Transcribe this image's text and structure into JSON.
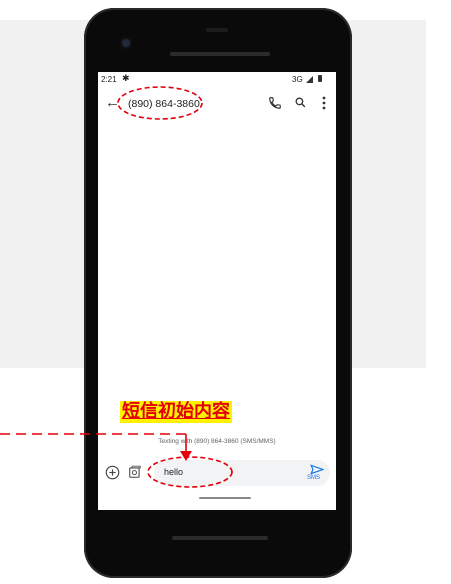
{
  "status_bar": {
    "time": "2:21",
    "settings_icon": "gear-icon",
    "network": "3G"
  },
  "app_bar": {
    "contact": "(890) 864-3860",
    "icons": [
      "back-arrow-icon",
      "phone-icon",
      "search-icon",
      "more-vert-icon"
    ]
  },
  "conversation": {
    "texting_note": "Texting with (890) 864-3860 (SMS/MMS)"
  },
  "compose": {
    "text": "hello",
    "send_label": "SMS",
    "icons": [
      "add-circle-icon",
      "gallery-icon",
      "send-icon"
    ]
  },
  "annotation": {
    "caption": "短信初始内容",
    "highlight_color": "#fff200",
    "text_color": "#e3000b",
    "marker_color": "#e3000b"
  },
  "colors": {
    "accent": "#1a73e8",
    "background_panel": "#f1f1f1"
  }
}
